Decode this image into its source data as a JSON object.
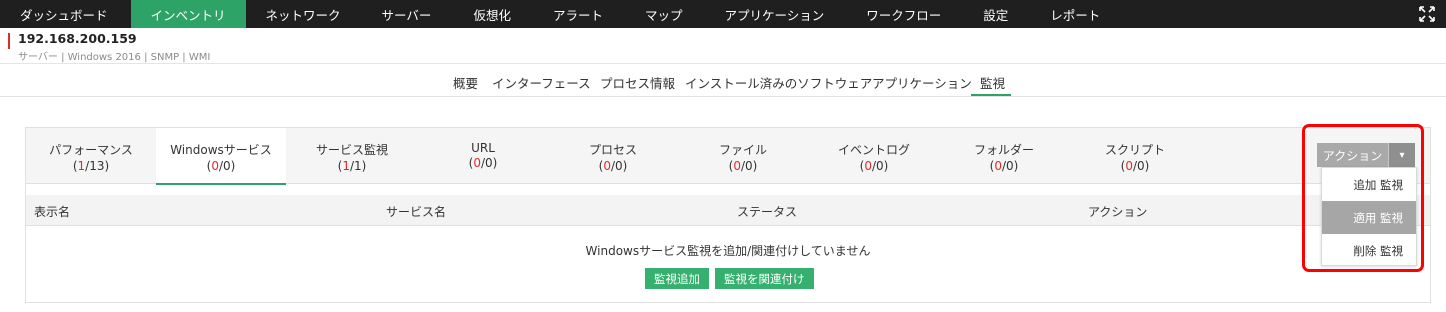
{
  "topnav": {
    "items": [
      {
        "label": "ダッシュボード",
        "active": false
      },
      {
        "label": "インベントリ",
        "active": true
      },
      {
        "label": "ネットワーク",
        "active": false
      },
      {
        "label": "サーバー",
        "active": false
      },
      {
        "label": "仮想化",
        "active": false
      },
      {
        "label": "アラート",
        "active": false
      },
      {
        "label": "マップ",
        "active": false
      },
      {
        "label": "アプリケーション",
        "active": false
      },
      {
        "label": "ワークフロー",
        "active": false
      },
      {
        "label": "設定",
        "active": false
      },
      {
        "label": "レポート",
        "active": false
      }
    ],
    "expand_icon": "expand-arrows-icon",
    "active_color": "#2ea367",
    "bg_color": "#1f1f1f"
  },
  "device": {
    "ip": "192.168.200.159",
    "details": "サーバー | Windows 2016 | SNMP | WMI"
  },
  "subtabs": [
    {
      "label": "概要"
    },
    {
      "label": "インターフェース"
    },
    {
      "label": "プロセス情報"
    },
    {
      "label": "インストール済みのソフトウェア"
    },
    {
      "label": "アプリケーション"
    },
    {
      "label": "監視"
    }
  ],
  "monitor_tabs": [
    {
      "label": "パフォーマンス",
      "num": "1",
      "den": "13",
      "num_red": true
    },
    {
      "label": "Windowsサービス",
      "num": "0",
      "den": "0",
      "num_red": true,
      "active": true
    },
    {
      "label": "サービス監視",
      "num": "1",
      "den": "1",
      "num_red": true
    },
    {
      "label": "URL",
      "num": "0",
      "den": "0",
      "num_red": true
    },
    {
      "label": "プロセス",
      "num": "0",
      "den": "0",
      "num_red": true
    },
    {
      "label": "ファイル",
      "num": "0",
      "den": "0",
      "num_red": true
    },
    {
      "label": "イベントログ",
      "num": "0",
      "den": "0",
      "num_red": true
    },
    {
      "label": "フォルダー",
      "num": "0",
      "den": "0",
      "num_red": true
    },
    {
      "label": "スクリプト",
      "num": "0",
      "den": "0",
      "num_red": true
    }
  ],
  "table": {
    "columns": [
      "表示名",
      "サービス名",
      "ステータス",
      "アクション"
    ],
    "empty_message": "Windowsサービス監視を追加/関連付けしていません",
    "add_button": "監視追加",
    "associate_button": "監視を関連付け"
  },
  "action_menu": {
    "button_label": "アクション",
    "caret": "▾",
    "items": [
      {
        "label": "追加 監視",
        "selected": false
      },
      {
        "label": "適用 監視",
        "selected": true
      },
      {
        "label": "削除 監視",
        "selected": false
      }
    ]
  }
}
